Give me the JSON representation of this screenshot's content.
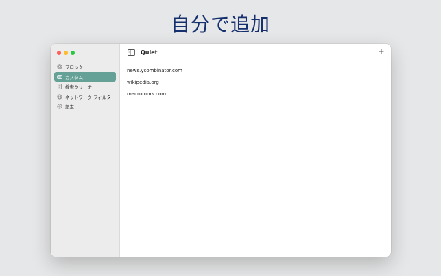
{
  "headline": "自分で追加",
  "window": {
    "title": "Quiet",
    "sidebar": {
      "items": [
        {
          "label": "ブロック",
          "icon": "shield-icon",
          "active": false
        },
        {
          "label": "カスタム",
          "icon": "keyboard-icon",
          "active": true
        },
        {
          "label": "検索クリーナー",
          "icon": "document-icon",
          "active": false
        },
        {
          "label": "ネットワーク フィルタ",
          "icon": "globe-icon",
          "active": false
        },
        {
          "label": "設定",
          "icon": "gear-icon",
          "active": false
        }
      ]
    },
    "domains": [
      "news.ycombinator.com",
      "wikipedia.org",
      "macrumors.com"
    ]
  },
  "colors": {
    "accent": "#65a197",
    "headline": "#16306e",
    "background": "#e6e7e8"
  }
}
